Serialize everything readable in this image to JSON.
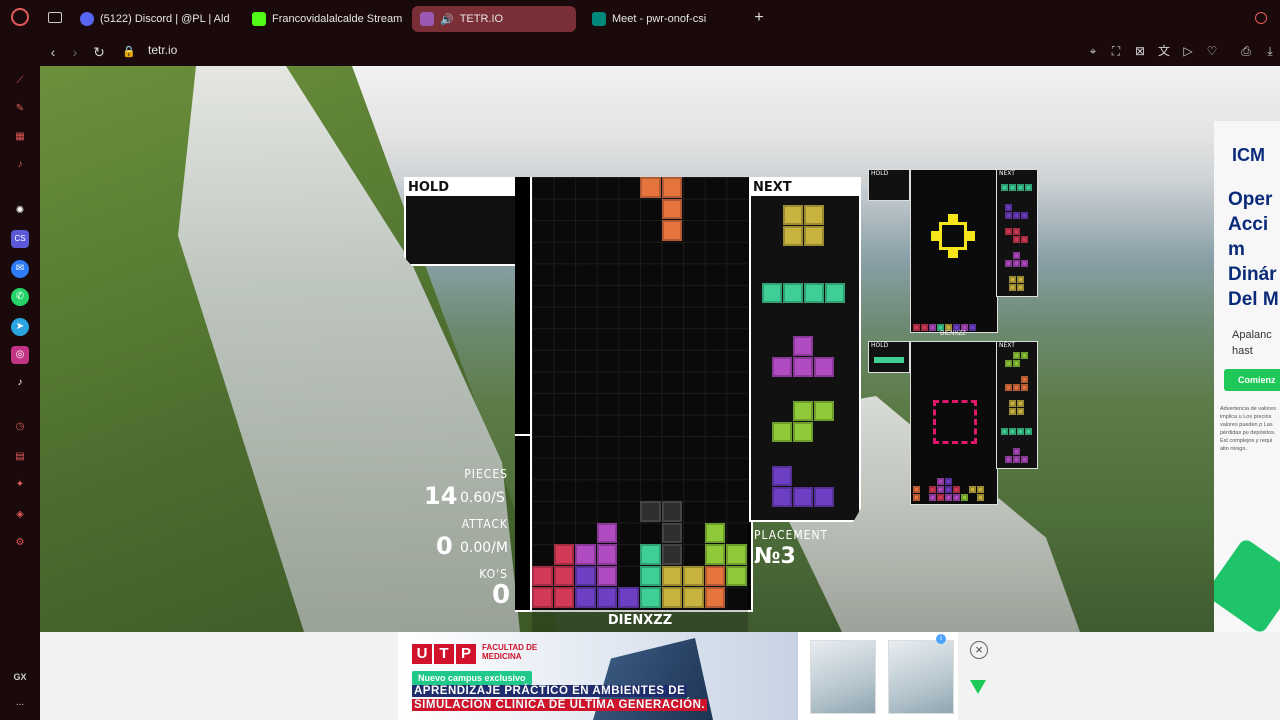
{
  "browser": {
    "tabs": [
      {
        "title": "(5122) Discord | @PL | Ald",
        "favicon_color": "#5865f2"
      },
      {
        "title": "Francovidalalcalde Stream",
        "favicon_color": "#53fc18"
      },
      {
        "title": "TETR.IO",
        "favicon_color": "#9b59b6",
        "active": true
      },
      {
        "title": "Meet - pwr-onof-csi",
        "favicon_color": "#00897b"
      }
    ],
    "new_tab_label": "+",
    "url": "tetr.io",
    "sidebar_badge": "GX",
    "sidebar_more": "...",
    "accent": "#e25a5a"
  },
  "game": {
    "hold_label": "HOLD",
    "next_label": "NEXT",
    "stats": {
      "pieces_label": "PIECES",
      "pieces_value": "14",
      "pieces_rate": "0.60/S",
      "attack_label": "ATTACK",
      "attack_value": "0",
      "attack_rate": "0.00/M",
      "kos_label": "KO'S",
      "kos_value": "0",
      "placement_label": "PLACEMENT",
      "placement_value": "№3"
    },
    "username": "DIENXZZ",
    "piece_colors": {
      "L": "#e5743f",
      "O": "#c9b340",
      "I": "#3fcf96",
      "T": "#b04bc2",
      "S": "#8fc93a",
      "J": "#6d3fc2",
      "Z": "#d23a57",
      "G": "#2f2f2f"
    }
  },
  "opponents": [
    {
      "hold_label": "HOLD",
      "next_label": "NEXT",
      "name": "DIENXZZ"
    },
    {
      "hold_label": "HOLD",
      "next_label": "NEXT",
      "name": ""
    }
  ],
  "right_ad": {
    "brand": "ICM",
    "headline": "Oper Acci m Dinár Del M",
    "sub": "Apalanc hast",
    "cta": "Comienz",
    "disclaimer": "Advertencia de valores implica u Los precios valores pueden p Las pérdidas pu depósitos. Est complejos y requi alto riesgo."
  },
  "bottom_ad": {
    "utp_letters": [
      "U",
      "T",
      "P"
    ],
    "faculty": "FACULTAD DE MEDICINA",
    "pill": "Nuevo campus exclusivo",
    "line1": "APRENDIZAJE PRÁCTICO EN AMBIENTES DE",
    "line2": "SIMULACIÓN CLÍNICA DE ÚLTIMA GENERACIÓN.",
    "close_label": "×"
  }
}
